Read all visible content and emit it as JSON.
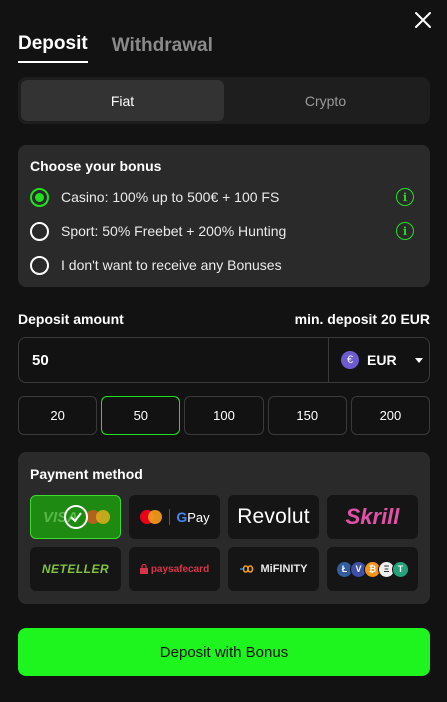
{
  "tabs": [
    {
      "label": "Deposit",
      "active": true
    },
    {
      "label": "Withdrawal",
      "active": false
    }
  ],
  "mode": {
    "items": [
      {
        "label": "Fiat",
        "active": true
      },
      {
        "label": "Crypto",
        "active": false
      }
    ]
  },
  "bonus": {
    "title": "Choose your bonus",
    "options": [
      {
        "label": "Casino: 100% up to 500€ + 100 FS",
        "selected": true,
        "info": true
      },
      {
        "label": "Sport: 50% Freebet + 200% Hunting",
        "selected": false,
        "info": true
      },
      {
        "label": "I don't want to receive any Bonuses",
        "selected": false,
        "info": false
      }
    ],
    "info_glyph": "i"
  },
  "amount": {
    "label": "Deposit amount",
    "min_label": "min. deposit 20 EUR",
    "value": "50",
    "currency": {
      "code": "EUR",
      "symbol": "€",
      "icon": "euro-icon"
    },
    "presets": [
      "20",
      "50",
      "100",
      "150",
      "200"
    ],
    "selected_preset": "50"
  },
  "payment": {
    "title": "Payment method",
    "methods": [
      {
        "name": "visa-mastercard",
        "text": "VISA",
        "selected": true
      },
      {
        "name": "mastercard-gpay",
        "text": "Pay",
        "selected": false
      },
      {
        "name": "revolut",
        "text": "Revolut",
        "selected": false
      },
      {
        "name": "skrill",
        "text": "Skrill",
        "selected": false
      },
      {
        "name": "neteller",
        "text": "NETELLER",
        "selected": false
      },
      {
        "name": "paysafecard",
        "text": "paysafecard",
        "selected": false
      },
      {
        "name": "mifinity",
        "text": "MiFINITY",
        "selected": false
      },
      {
        "name": "crypto-coins",
        "text": "Ł₮₿Ξ₮",
        "selected": false
      }
    ]
  },
  "submit": {
    "label": "Deposit with Bonus"
  },
  "colors": {
    "accent": "#22e01e",
    "button": "#1ef41e",
    "panel": "#2a2a2a",
    "background": "#121212"
  }
}
